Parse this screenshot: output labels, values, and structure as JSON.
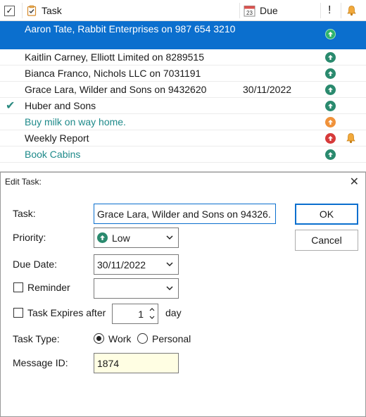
{
  "task_list": {
    "columns": {
      "task": "Task",
      "due": "Due",
      "priority_marker": "!",
      "calendar_icon_label": "23"
    },
    "rows": [
      {
        "text": "Aaron Tate, Rabbit Enterprises on 987 654 3210",
        "due": "",
        "priority": "low",
        "selected": true
      },
      {
        "text": "Kaitlin Carney, Elliott Limited on 8289515",
        "due": "",
        "priority": "low"
      },
      {
        "text": "Bianca Franco, Nichols LLC on 7031191",
        "due": "",
        "priority": "low"
      },
      {
        "text": "Grace Lara, Wilder and Sons on 9432620",
        "due": "30/11/2022",
        "priority": "low"
      },
      {
        "text": "Huber and Sons",
        "due": "",
        "priority": "low",
        "completed": true
      },
      {
        "text": "Buy milk on way home.",
        "due": "",
        "priority": "medium",
        "personal": true
      },
      {
        "text": "Weekly Report",
        "due": "",
        "priority": "high",
        "reminder": true
      },
      {
        "text": "Book Cabins",
        "due": "",
        "priority": "low",
        "personal": true
      }
    ]
  },
  "dialog": {
    "title": "Edit Task:",
    "task_label": "Task:",
    "task_value": "Grace Lara, Wilder and Sons on 94326.",
    "priority_label": "Priority:",
    "priority_value": "Low",
    "due_label": "Due Date:",
    "due_value": "30/11/2022",
    "reminder_label": "Reminder",
    "reminder_value": "",
    "expires_label": "Task Expires after",
    "expires_value": "1",
    "expires_unit": "day",
    "type_label": "Task Type:",
    "type_work": "Work",
    "type_personal": "Personal",
    "type_selected": "Work",
    "message_label": "Message ID:",
    "message_value": "1874",
    "ok_label": "OK",
    "cancel_label": "Cancel"
  },
  "colors": {
    "selection": "#0b6fce",
    "priority_low": "#2a8a6e",
    "priority_medium": "#f0923a",
    "priority_high": "#d63a3a",
    "personal_text": "#1e8a8a",
    "message_field": "#fffee3"
  },
  "icons": {
    "header_checkbox": "check-icon",
    "header_task": "clipboard-icon",
    "header_due": "calendar-icon",
    "header_reminder": "bell-icon",
    "priority": "arrow-up-circle-icon",
    "completed": "checkmark-icon"
  }
}
